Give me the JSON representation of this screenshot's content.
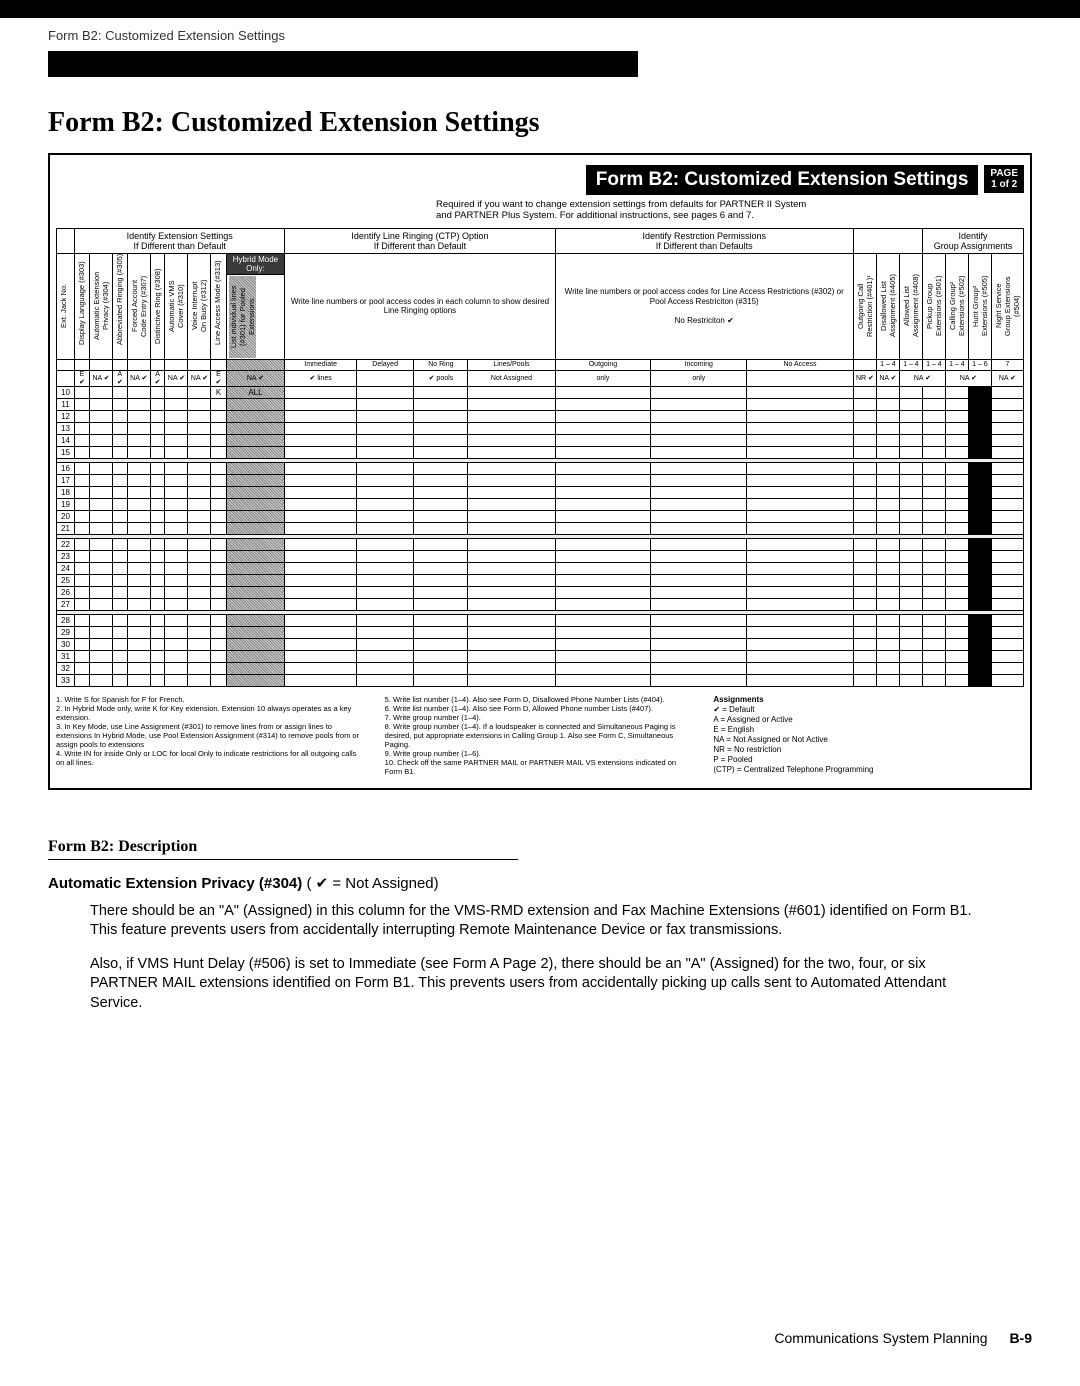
{
  "header_label": "Form B2: Customized Extension Settings",
  "main_title": "Form B2: Customized Extension Settings",
  "banner_title": "Form B2: Customized Extension Settings",
  "page_badge_top": "PAGE",
  "page_badge_bot": "1 of 2",
  "required_line1": "Required if you want to change extension settings from defaults for PARTNER II System",
  "required_line2": "and PARTNER Plus System. For additional instructions, see pages 6 and 7.",
  "section_heads": {
    "s1": "Identify Extension Settings\nIf Different than Default",
    "s2": "Identify Line Ringing (CTP) Option\nIf Different than Default",
    "s3": "Identify Restrction Permissions\nIf Different than Defaults",
    "s4": "Identify\nGroup Assignments"
  },
  "rot_cols": {
    "c0": "Ext. Jack No.",
    "c1": "Display Language (#303)",
    "c2": "Automatic Extension\nPrivacy (#304)",
    "c3": "Abbreviated Ringing (#305)",
    "c4": "Forced Account\nCode Entry (#307)",
    "c5": "Distinctive Ring (#308)",
    "c6": "Automatic VMS\nCover (#310)",
    "c7": "Voice Interrupt\nOn Busy (#312)",
    "c8": "Line Access Mode (#313)",
    "c9": "List individual lines\n(#301) for Pooled\nExtensions",
    "hybrid": "Hybrid Mode Only:",
    "wide_left": "Write line numbers or pool access codes in each column to show desired Line Ringing options",
    "wide_right": "Write line numbers or pool access codes for Line Access Restrictions (#302) or Pool Access Restriciton (#315)\n\nNo Restriciton ✔",
    "c10": "Outgoing Call\nRestriction (#401)¹",
    "c11": "Disallowed List\nAssignment (#405)",
    "c12": "Allowed List\nAssignment (#408)",
    "c13": "Pickup Group\nExtensions (#501)",
    "c14": "Calling Group²\nExtensions (#502)",
    "c15": "Hunt Group³\nExtensions (#505)",
    "c16": "Night Service\nGroup Extensions (#504)"
  },
  "sub_row": {
    "immediate": "Immediate",
    "delayed": "Delayed",
    "noring": "No Ring",
    "linespools": "Lines/Pools",
    "outgoing": "Outgoing",
    "incoming": "Incoming",
    "noaccess": "No Access"
  },
  "defaults_row": {
    "d0": "E ✔",
    "d1": "NA ✔",
    "d2": "A ✔",
    "d3": "NA ✔",
    "d4": "A ✔",
    "d5": "NA ✔",
    "d6": "NA ✔",
    "d7": "E ✔",
    "d8": "NA ✔",
    "immediate": "✔ lines",
    "delayed": "",
    "noring": "✔ pools",
    "linespools": "Not Assigned",
    "outgoing": "only",
    "incoming": "only",
    "noaccess": "",
    "nr": "NR ✔",
    "r1": "1 – 4",
    "r2": "1 – 4",
    "r3": "1 – 4",
    "r4": "1 – 4",
    "r5": "1 – 6",
    "r6": "7",
    "na1": "NA ✔",
    "na2": "NA ✔",
    "na3": "NA ✔",
    "na4": "NA ✔"
  },
  "row_nums": [
    "10",
    "11",
    "12",
    "13",
    "14",
    "15",
    "16",
    "17",
    "18",
    "19",
    "20",
    "21",
    "22",
    "23",
    "24",
    "25",
    "26",
    "27",
    "28",
    "29",
    "30",
    "31",
    "32",
    "33"
  ],
  "row10": {
    "col8": "K",
    "col9": "ALL"
  },
  "footnotes_left": [
    "1. Write S for Spanish for F for French.",
    "2. In Hybrid Mode only, write K for Key extension. Extension 10 always operates as a key extension.",
    "3. In Key Mode, use Line Assignment (#301) to remove lines from or assign lines to extensions In Hybrid Mode, use Pool Extension Assignment (#314) to remove pools from or assign pools to extensions",
    "4. Write IN for inside Only or LOC for local Only to indicate restrictions for all outgoing calls on all lines."
  ],
  "footnotes_mid": [
    "5. Write list number (1–4). Also see Form D, Disallowed Phone Number Lists (#404).",
    "6. Write list number (1–4). Also see Form D, Allowed Phone number Lists (#407).",
    "7. Write group number (1–4).",
    "8. Write group number (1–4). If a loudspeaker is connected and Simultaneous Paging is desired, put appropriate extensions in Calling Group 1. Also see Form C, Simultaneous Paging.",
    "9. Write group number (1–6).",
    "10. Check off the same PARTNER MAIL or PARTNER MAIL VS extensions indicated on Form B1."
  ],
  "assignments": {
    "title": "Assignments",
    "items": [
      "✔   =  Default",
      "A    =   Assigned or Active",
      "E    =   English",
      "NA  =   Not Assigned or Not Active",
      "NR  =   No   restriction",
      "P    =   Pooled",
      "(CTP) =  Centralized   Telephone   Programming"
    ]
  },
  "desc": {
    "heading": "Form B2: Description",
    "feature_title": "Automatic Extension Privacy (#304)",
    "feature_note": " ( ✔ = Not Assigned)",
    "p1": "There should be an \"A\" (Assigned) in this column for the VMS-RMD extension and Fax Machine Extensions (#601) identified on Form B1. This feature prevents users from accidentally interrupting Remote Maintenance Device or fax transmissions.",
    "p2": "Also, if VMS Hunt Delay (#506) is set to Immediate (see Form A Page 2), there should be an \"A\" (Assigned) for the two, four, or six PARTNER MAIL extensions identified on Form B1. This prevents users from accidentally picking up calls sent to Automated Attendant Service."
  },
  "footer": {
    "text": "Communications System Planning",
    "page": "B-9"
  }
}
